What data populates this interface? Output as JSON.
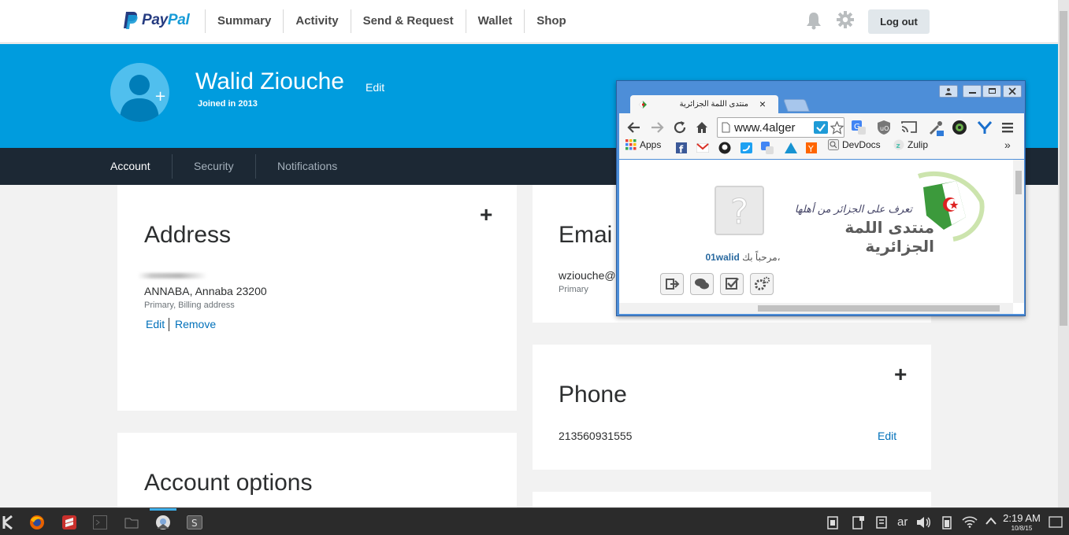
{
  "paypal": {
    "logo_part1": "Pay",
    "logo_part2": "Pal",
    "nav": [
      "Summary",
      "Activity",
      "Send & Request",
      "Wallet",
      "Shop"
    ],
    "logout_label": "Log out",
    "profile": {
      "name": "Walid Ziouche",
      "edit_label": "Edit",
      "joined": "Joined in 2013"
    },
    "subnav": [
      "Account",
      "Security",
      "Notifications"
    ],
    "address": {
      "title": "Address",
      "line": "ANNABA, Annaba 23200",
      "note": "Primary, Billing address",
      "edit_label": "Edit",
      "remove_label": "Remove",
      "add_symbol": "+"
    },
    "email": {
      "title": "Emai",
      "value": "wziouche@",
      "note": "Primary"
    },
    "phone": {
      "title": "Phone",
      "number": "213560931555",
      "edit_label": "Edit",
      "add_symbol": "+"
    },
    "account_options": {
      "title": "Account options"
    }
  },
  "chrome": {
    "tab_title": "منتدى اللمة الجزائرية",
    "tab_close": "×",
    "url": "www.4alger",
    "bookmarks": [
      "Apps",
      "DevDocs",
      "Zulip"
    ],
    "bookmarks_more": "»",
    "site": {
      "tagline": "تعرف على الجزائر من أهلها",
      "name": "منتدى اللمة الجزائرية",
      "welcome_prefix": "مرحباً بك،",
      "username": "01walid"
    }
  },
  "taskbar": {
    "language": "ar",
    "time": "2:19 AM",
    "date": "10/8/15"
  },
  "colors": {
    "paypal_blue": "#009cde",
    "paypal_navy": "#1c2834",
    "link_blue": "#0070ba",
    "chrome_frame": "#4d8ed8"
  }
}
